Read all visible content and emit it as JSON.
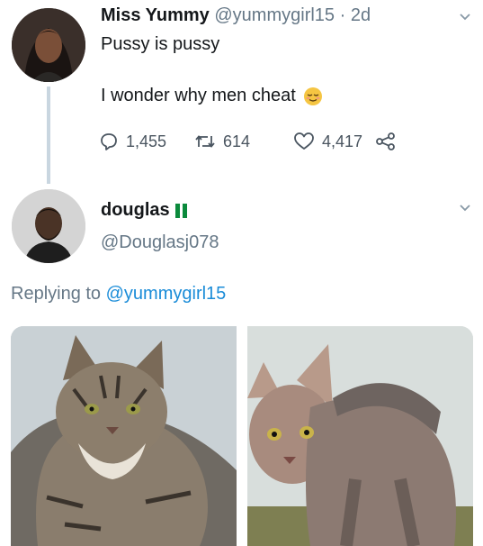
{
  "tweet1": {
    "name": "Miss Yummy",
    "handle": "@yummygirl15",
    "separator": "·",
    "age": "2d",
    "line1": "Pussy is pussy",
    "line2": "I wonder why men cheat",
    "emoji": "relieved-face",
    "actions": {
      "replies": "1,455",
      "retweets": "614",
      "likes": "4,417"
    }
  },
  "tweet2": {
    "name": "douglas",
    "flag": "nigeria-flag",
    "handle": "@Douglasj078",
    "replying_prefix": "Replying to",
    "replying_mention": "@yummygirl15",
    "images": [
      "fluffy-tabby-cat-photo",
      "hairless-lykoi-cat-photo"
    ]
  },
  "colors": {
    "text": "#14171a",
    "secondary": "#657786",
    "link": "#1a8cd8",
    "thread_line": "#c9d6e0",
    "flag_green": "#0b8a3c"
  }
}
